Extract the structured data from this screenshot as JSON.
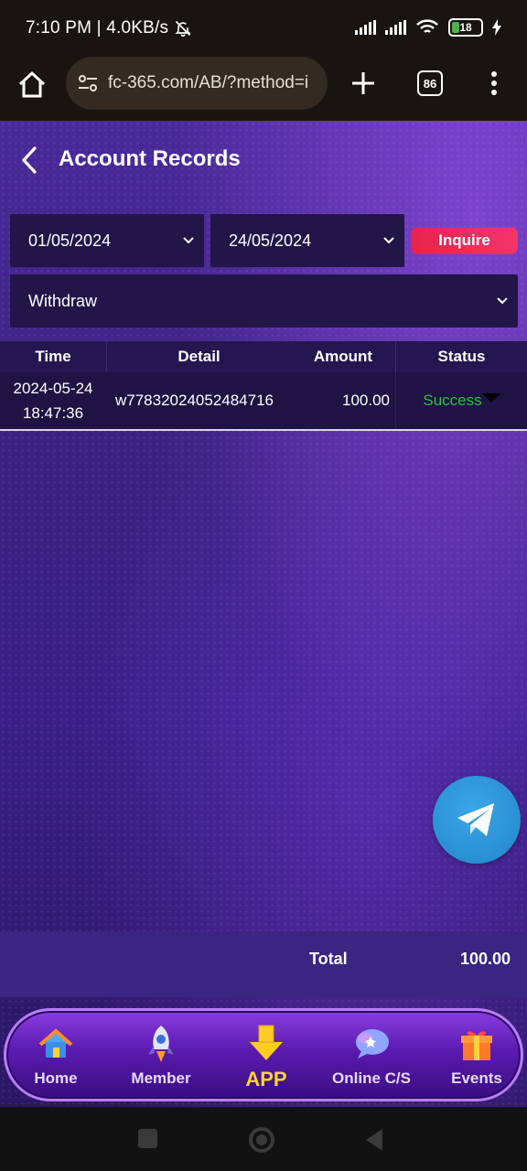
{
  "status_bar": {
    "time_speed": "7:10 PM | 4.0KB/s",
    "battery": "18"
  },
  "browser": {
    "url": "fc-365.com/AB/?method=i",
    "tab_count": "86"
  },
  "header": {
    "title": "Account Records"
  },
  "filters": {
    "start_date": "01/05/2024",
    "end_date": "24/05/2024",
    "inquire_label": "Inquire",
    "record_type": "Withdraw"
  },
  "table": {
    "columns": [
      "Time",
      "Detail",
      "Amount",
      "Status"
    ],
    "rows": [
      {
        "date": "2024-05-24",
        "time": "18:47:36",
        "detail": "w77832024052484716",
        "amount": "100.00",
        "status": "Success"
      }
    ]
  },
  "totals": {
    "label": "Total",
    "value": "100.00"
  },
  "bottom_nav": {
    "items": [
      {
        "label": "Home",
        "icon": "home-icon"
      },
      {
        "label": "Member",
        "icon": "rocket-icon"
      },
      {
        "label": "APP",
        "icon": "download-arrow-icon"
      },
      {
        "label": "Online C/S",
        "icon": "chat-icon"
      },
      {
        "label": "Events",
        "icon": "gift-icon"
      }
    ]
  },
  "colors": {
    "accent_red": "#e8234e",
    "success_green": "#2fbf4a",
    "app_yellow": "#ffd23a"
  }
}
